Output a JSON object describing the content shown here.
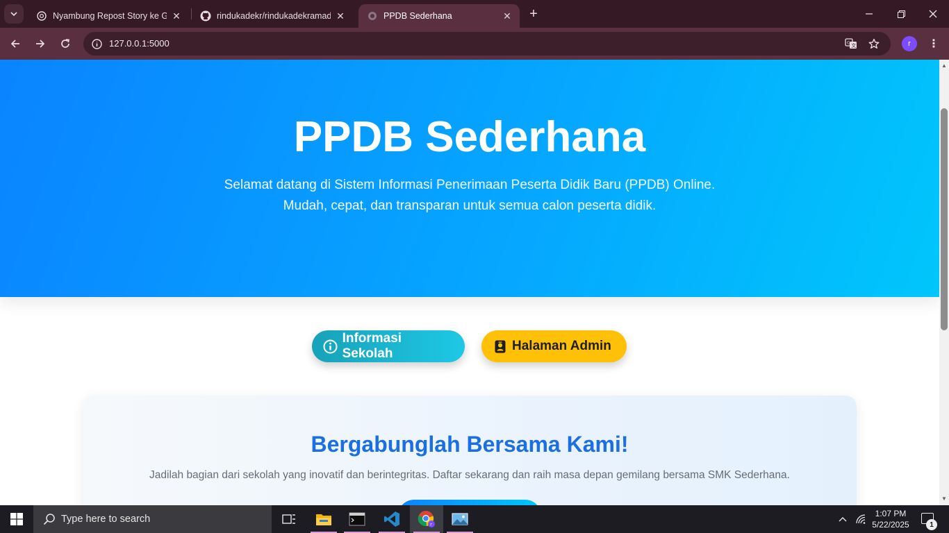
{
  "browser": {
    "tabs": [
      {
        "title": "Nyambung Repost Story ke GitHub",
        "favicon": "openai-icon",
        "active": false
      },
      {
        "title": "rindukadekr/rindukadekramadhan",
        "favicon": "github-icon",
        "active": false
      },
      {
        "title": "PPDB Sederhana",
        "favicon": "globe-icon",
        "active": true
      }
    ],
    "url": "127.0.0.1:5000",
    "profile_initial": "r",
    "accent": "#5a2f40"
  },
  "page": {
    "hero": {
      "title": "PPDB Sederhana",
      "subtitle_line1": "Selamat datang di Sistem Informasi Penerimaan Peserta Didik Baru (PPDB) Online.",
      "subtitle_line2": "Mudah, cepat, dan transparan untuk semua calon peserta didik."
    },
    "buttons": {
      "info_label": "Informasi Sekolah",
      "info_icon": "info-circle-icon",
      "admin_label": "Halaman Admin",
      "admin_icon": "person-badge-icon"
    },
    "card": {
      "heading": "Bergabunglah Bersama Kami!",
      "text": "Jadilah bagian dari sekolah yang inovatif dan berintegritas. Daftar sekarang dan raih masa depan gemilang bersama SMK Sederhana."
    },
    "colors": {
      "hero_start": "#0a84ff",
      "hero_end": "#00c6fb",
      "info_button": "#17a2b8",
      "admin_button": "#ffc107",
      "card_heading": "#1c6fe0"
    }
  },
  "taskbar": {
    "search_placeholder": "Type here to search",
    "time": "1:07 PM",
    "date": "5/22/2025",
    "notification_count": "1"
  }
}
